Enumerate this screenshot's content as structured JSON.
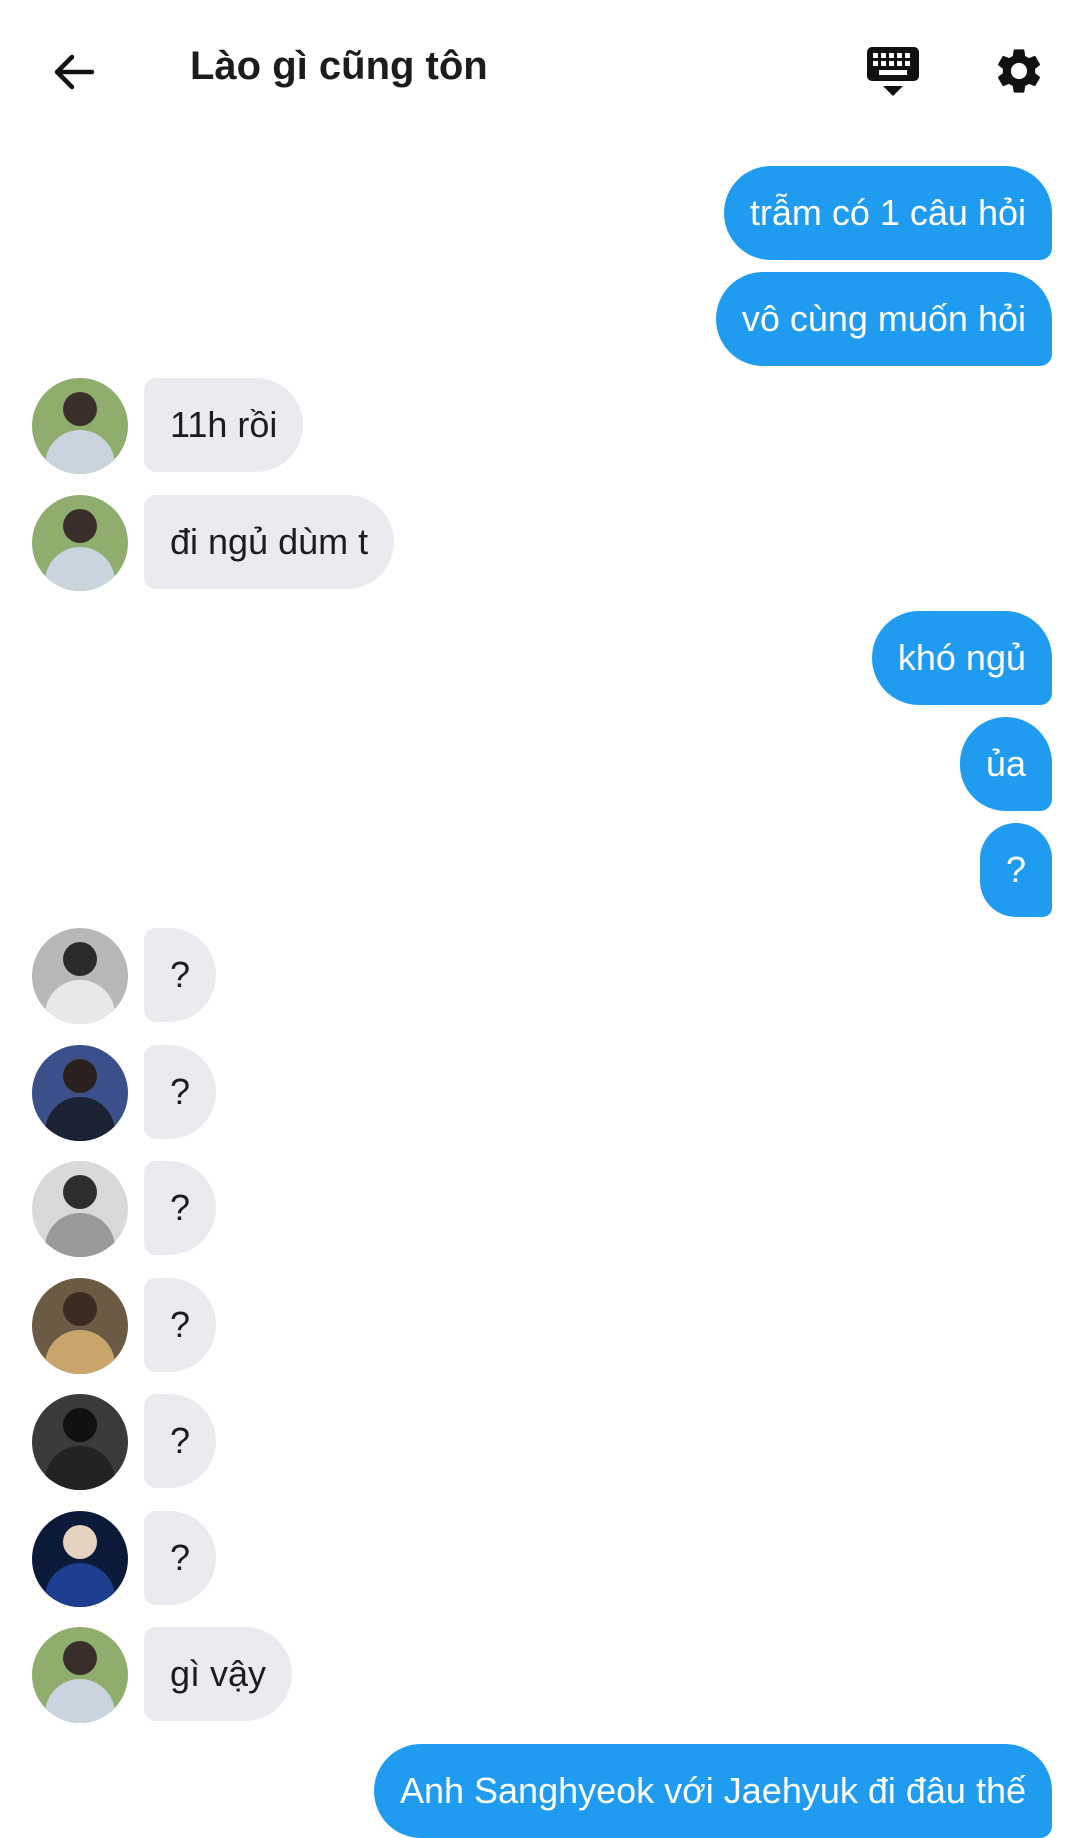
{
  "header": {
    "title": "Lào gì cũng tôn",
    "back_icon": "arrow-left-icon",
    "keyboard_icon": "keyboard-hide-icon",
    "settings_icon": "gear-icon"
  },
  "colors": {
    "outgoing_bubble": "#1f9bef",
    "incoming_bubble": "#e9ebee",
    "background": "#ffffff"
  },
  "messages": [
    {
      "side": "me",
      "text": "trẫm có 1 câu hỏi"
    },
    {
      "side": "me",
      "text": "vô cùng muốn hỏi"
    },
    {
      "side": "them",
      "text": "11h rồi"
    },
    {
      "side": "them",
      "text": "đi ngủ dùm t"
    },
    {
      "side": "me",
      "text": "khó ngủ"
    },
    {
      "side": "me",
      "text": "ủa"
    },
    {
      "side": "me",
      "text": "?"
    },
    {
      "side": "them",
      "text": "?"
    },
    {
      "side": "them",
      "text": "?"
    },
    {
      "side": "them",
      "text": "?"
    },
    {
      "side": "them",
      "text": "?"
    },
    {
      "side": "them",
      "text": "?"
    },
    {
      "side": "them",
      "text": "?"
    },
    {
      "side": "them",
      "text": "gì vậy"
    },
    {
      "side": "me",
      "text": "Anh Sanghyeok với Jaehyuk đi đâu thế"
    }
  ]
}
